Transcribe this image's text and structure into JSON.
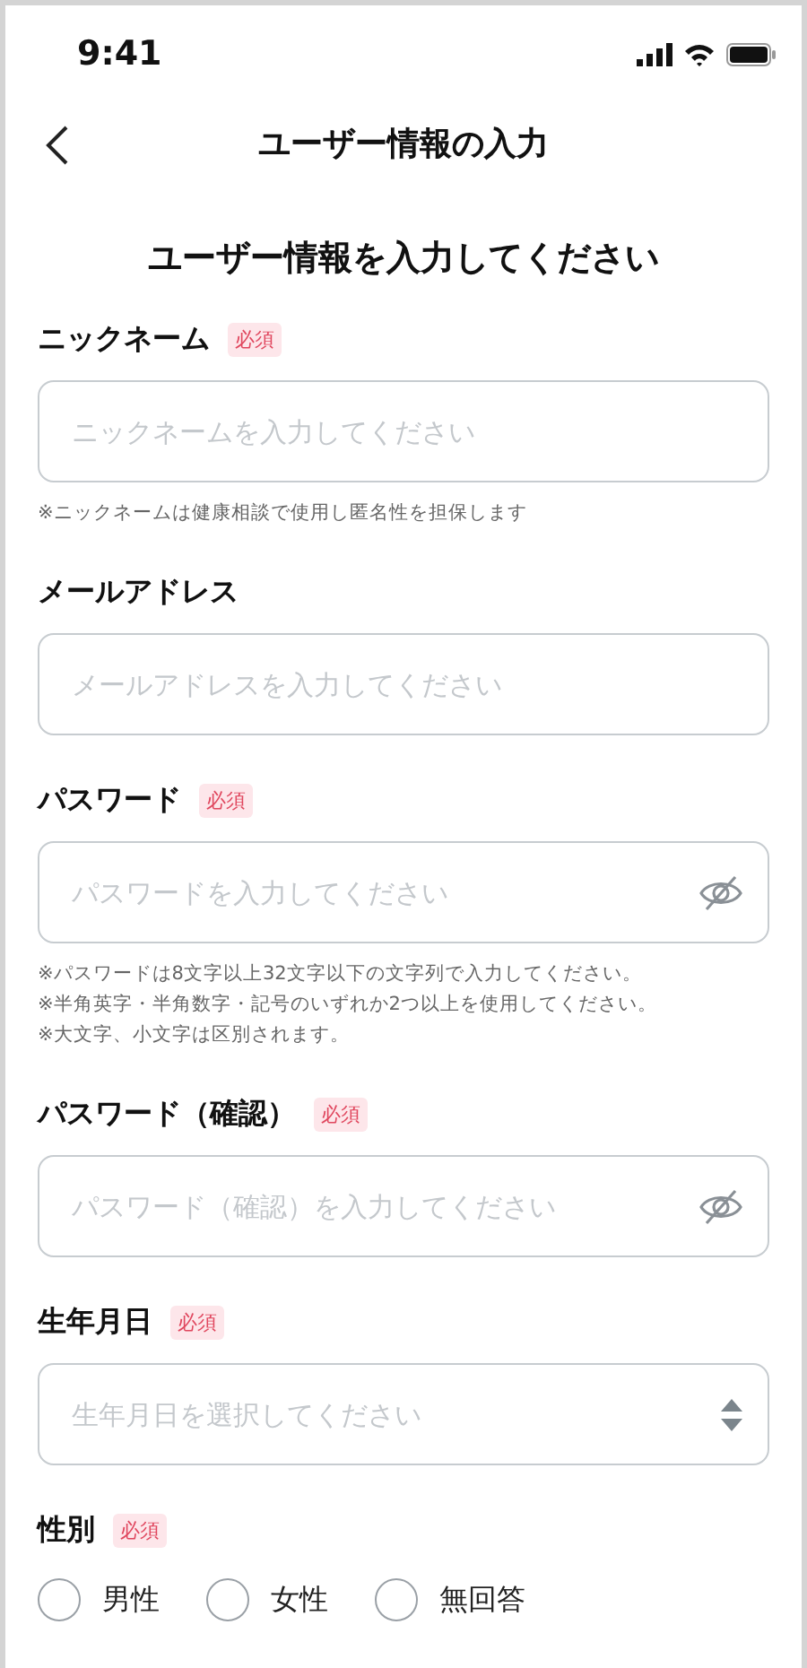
{
  "status_bar": {
    "time": "9:41"
  },
  "header": {
    "title": "ユーザー情報の入力"
  },
  "heading": "ユーザー情報を入力してください",
  "fields": [
    {
      "label": "ニックネーム",
      "badge": "必須",
      "kind": "text",
      "placeholder": "ニックネームを入力してください",
      "notes": [
        "※ニックネームは健康相談で使用し匿名性を担保します"
      ]
    },
    {
      "label": "メールアドレス",
      "kind": "text",
      "placeholder": "メールアドレスを入力してください"
    },
    {
      "label": "パスワード",
      "badge": "必須",
      "kind": "password",
      "placeholder": "パスワードを入力してください",
      "notes": [
        "※パスワードは8文字以上32文字以下の文字列で入力してください。",
        "※半角英字・半角数字・記号のいずれか2つ以上を使用してください。",
        "※大文字、小文字は区別されます。"
      ]
    },
    {
      "label": "パスワード（確認）",
      "badge": "必須",
      "kind": "password",
      "placeholder": "パスワード（確認）を入力してください"
    },
    {
      "label": "生年月日",
      "badge": "必須",
      "kind": "select",
      "placeholder": "生年月日を選択してください"
    },
    {
      "label": "性別",
      "badge": "必須",
      "kind": "radio",
      "options": [
        {
          "label": "男性",
          "selected": false
        },
        {
          "label": "女性",
          "selected": false
        },
        {
          "label": "無回答",
          "selected": false
        }
      ]
    }
  ]
}
